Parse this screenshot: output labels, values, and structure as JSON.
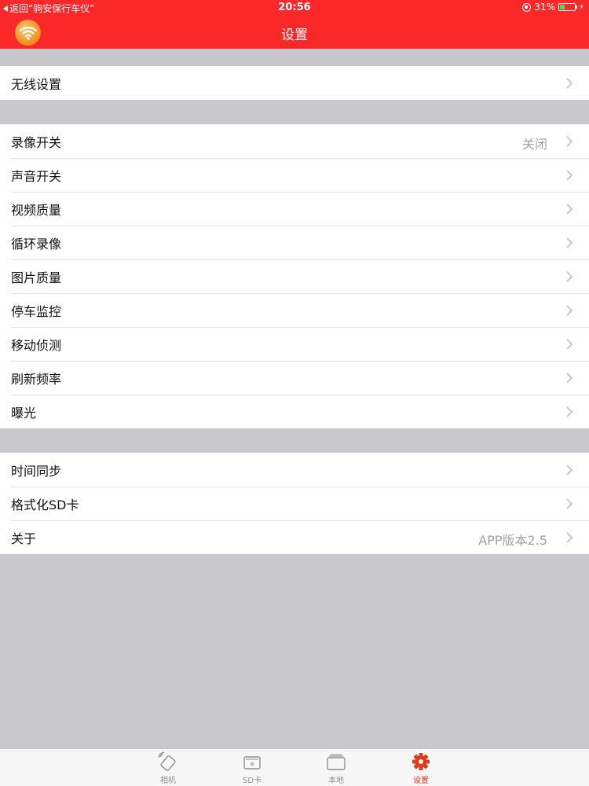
{
  "status_bar": {
    "back_label": "返回“驹安保行车仪”",
    "time": "20:56",
    "battery_percent": "31%",
    "battery_level": 0.31
  },
  "nav": {
    "title": "设置",
    "left_icon": "wifi-icon",
    "accent_color": "#fa2828"
  },
  "groups": [
    {
      "rows": [
        {
          "label": "无线设置",
          "detail": ""
        }
      ]
    },
    {
      "rows": [
        {
          "label": "录像开关",
          "detail": "关闭"
        },
        {
          "label": "声音开关",
          "detail": ""
        },
        {
          "label": "视频质量",
          "detail": ""
        },
        {
          "label": "循环录像",
          "detail": ""
        },
        {
          "label": "图片质量",
          "detail": ""
        },
        {
          "label": "停车监控",
          "detail": ""
        },
        {
          "label": "移动侦测",
          "detail": ""
        },
        {
          "label": "刷新频率",
          "detail": ""
        },
        {
          "label": "曝光",
          "detail": ""
        }
      ]
    },
    {
      "rows": [
        {
          "label": "时间同步",
          "detail": ""
        },
        {
          "label": "格式化SD卡",
          "detail": ""
        },
        {
          "label": "关于",
          "detail": "APP版本2.5"
        }
      ]
    }
  ],
  "tabbar": {
    "tabs": [
      {
        "label": "相机",
        "icon": "camera-icon",
        "active": false
      },
      {
        "label": "SD卡",
        "icon": "sd-card-icon",
        "active": false
      },
      {
        "label": "本地",
        "icon": "folder-icon",
        "active": false
      },
      {
        "label": "设置",
        "icon": "gear-icon",
        "active": true
      }
    ],
    "active_color": "#e03a1e"
  }
}
